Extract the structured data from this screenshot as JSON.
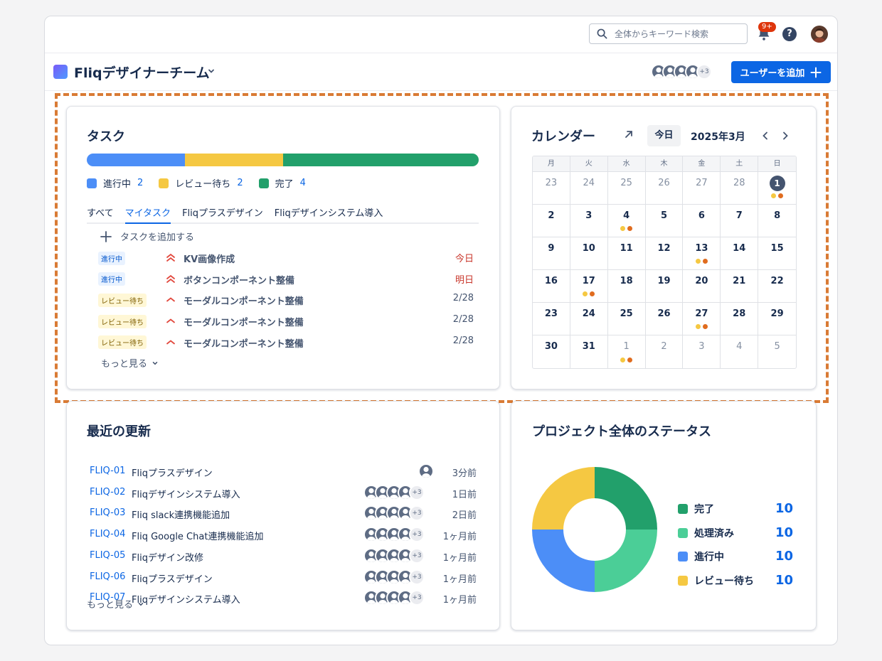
{
  "header": {
    "search_placeholder": "全体からキーワード検索",
    "notification_badge": "9+",
    "help_label": "?"
  },
  "project": {
    "name": "Fliqデザイナーチーム",
    "members_more": "+3",
    "add_user_label": "ユーザーを追加"
  },
  "tasks": {
    "title": "タスク",
    "progress": [
      {
        "label": "進行中",
        "count": "2",
        "color": "#4c8ef7"
      },
      {
        "label": "レビュー待ち",
        "count": "2",
        "color": "#f5c842"
      },
      {
        "label": "完了",
        "count": "4",
        "color": "#22a06b"
      }
    ],
    "tabs": [
      "すべて",
      "マイタスク",
      "Fliqプラスデザイン",
      "Fliqデザインシステム導入"
    ],
    "active_tab": "マイタスク",
    "add_task_label": "タスクを追加する",
    "items": [
      {
        "status": "進行中",
        "priority": "highest",
        "name": "KV画像作成",
        "due": "今日"
      },
      {
        "status": "進行中",
        "priority": "highest",
        "name": "ボタンコンポーネント整備",
        "due": "明日"
      },
      {
        "status": "レビュー待ち",
        "priority": "high",
        "name": "モーダルコンポーネント整備",
        "due": "2/28"
      },
      {
        "status": "レビュー待ち",
        "priority": "high",
        "name": "モーダルコンポーネント整備",
        "due": "2/28"
      },
      {
        "status": "レビュー待ち",
        "priority": "high",
        "name": "モーダルコンポーネント整備",
        "due": "2/28"
      }
    ],
    "more_label": "もっと見る"
  },
  "calendar": {
    "title": "カレンダー",
    "today_label": "今日",
    "month_label": "2025年3月",
    "weekdays": [
      "月",
      "火",
      "水",
      "木",
      "金",
      "土",
      "日"
    ],
    "weeks": [
      [
        {
          "d": "23",
          "other": true
        },
        {
          "d": "24",
          "other": true
        },
        {
          "d": "25",
          "other": true
        },
        {
          "d": "26",
          "other": true
        },
        {
          "d": "27",
          "other": true
        },
        {
          "d": "28",
          "other": true
        },
        {
          "d": "1",
          "current": true,
          "dots": true
        }
      ],
      [
        {
          "d": "2"
        },
        {
          "d": "3"
        },
        {
          "d": "4",
          "dots": true
        },
        {
          "d": "5"
        },
        {
          "d": "6"
        },
        {
          "d": "7"
        },
        {
          "d": "8"
        }
      ],
      [
        {
          "d": "9"
        },
        {
          "d": "10"
        },
        {
          "d": "11"
        },
        {
          "d": "12"
        },
        {
          "d": "13",
          "dots": true
        },
        {
          "d": "14"
        },
        {
          "d": "15"
        }
      ],
      [
        {
          "d": "16"
        },
        {
          "d": "17",
          "dots": true
        },
        {
          "d": "18"
        },
        {
          "d": "19"
        },
        {
          "d": "20"
        },
        {
          "d": "21"
        },
        {
          "d": "22"
        }
      ],
      [
        {
          "d": "23"
        },
        {
          "d": "24"
        },
        {
          "d": "25"
        },
        {
          "d": "26"
        },
        {
          "d": "27",
          "dots": true
        },
        {
          "d": "28"
        },
        {
          "d": "29"
        }
      ],
      [
        {
          "d": "30"
        },
        {
          "d": "31"
        },
        {
          "d": "1",
          "other": true,
          "dots": true
        },
        {
          "d": "2",
          "other": true
        },
        {
          "d": "3",
          "other": true
        },
        {
          "d": "4",
          "other": true
        },
        {
          "d": "5",
          "other": true
        }
      ]
    ],
    "dot_colors": [
      "#f5c842",
      "#e06c1f"
    ]
  },
  "updates": {
    "title": "最近の更新",
    "items": [
      {
        "key": "FLIQ-01",
        "title": "Fliqプラスデザイン",
        "single_avatar": true,
        "time": "3分前"
      },
      {
        "key": "FLIQ-02",
        "title": "Fliqデザインシステム導入",
        "more": "+3",
        "time": "1日前"
      },
      {
        "key": "FLIQ-03",
        "title": "Fliq slack連携機能追加",
        "more": "+3",
        "time": "2日前"
      },
      {
        "key": "FLIQ-04",
        "title": "Fliq Google Chat連携機能追加",
        "more": "+3",
        "time": "1ヶ月前"
      },
      {
        "key": "FLIQ-05",
        "title": "Fliqデザイン改修",
        "more": "+3",
        "time": "1ヶ月前"
      },
      {
        "key": "FLIQ-06",
        "title": "Fliqプラスデザイン",
        "more": "+3",
        "time": "1ヶ月前"
      },
      {
        "key": "FLIQ-07",
        "title": "Fliqデザインシステム導入",
        "more": "+3",
        "time": "1ヶ月前"
      }
    ],
    "more_label": "もっと見る"
  },
  "status": {
    "title": "プロジェクト全体のステータス",
    "legend": [
      {
        "label": "完了",
        "value": "10",
        "color": "#22a06b"
      },
      {
        "label": "処理済み",
        "value": "10",
        "color": "#4bce97"
      },
      {
        "label": "進行中",
        "value": "10",
        "color": "#4c8ef7"
      },
      {
        "label": "レビュー待ち",
        "value": "10",
        "color": "#f5c842"
      }
    ]
  },
  "chart_data": {
    "type": "pie",
    "categories": [
      "完了",
      "処理済み",
      "進行中",
      "レビュー待ち"
    ],
    "values": [
      10,
      10,
      10,
      10
    ],
    "colors": [
      "#22a06b",
      "#4bce97",
      "#4c8ef7",
      "#f5c842"
    ],
    "donut": true
  }
}
